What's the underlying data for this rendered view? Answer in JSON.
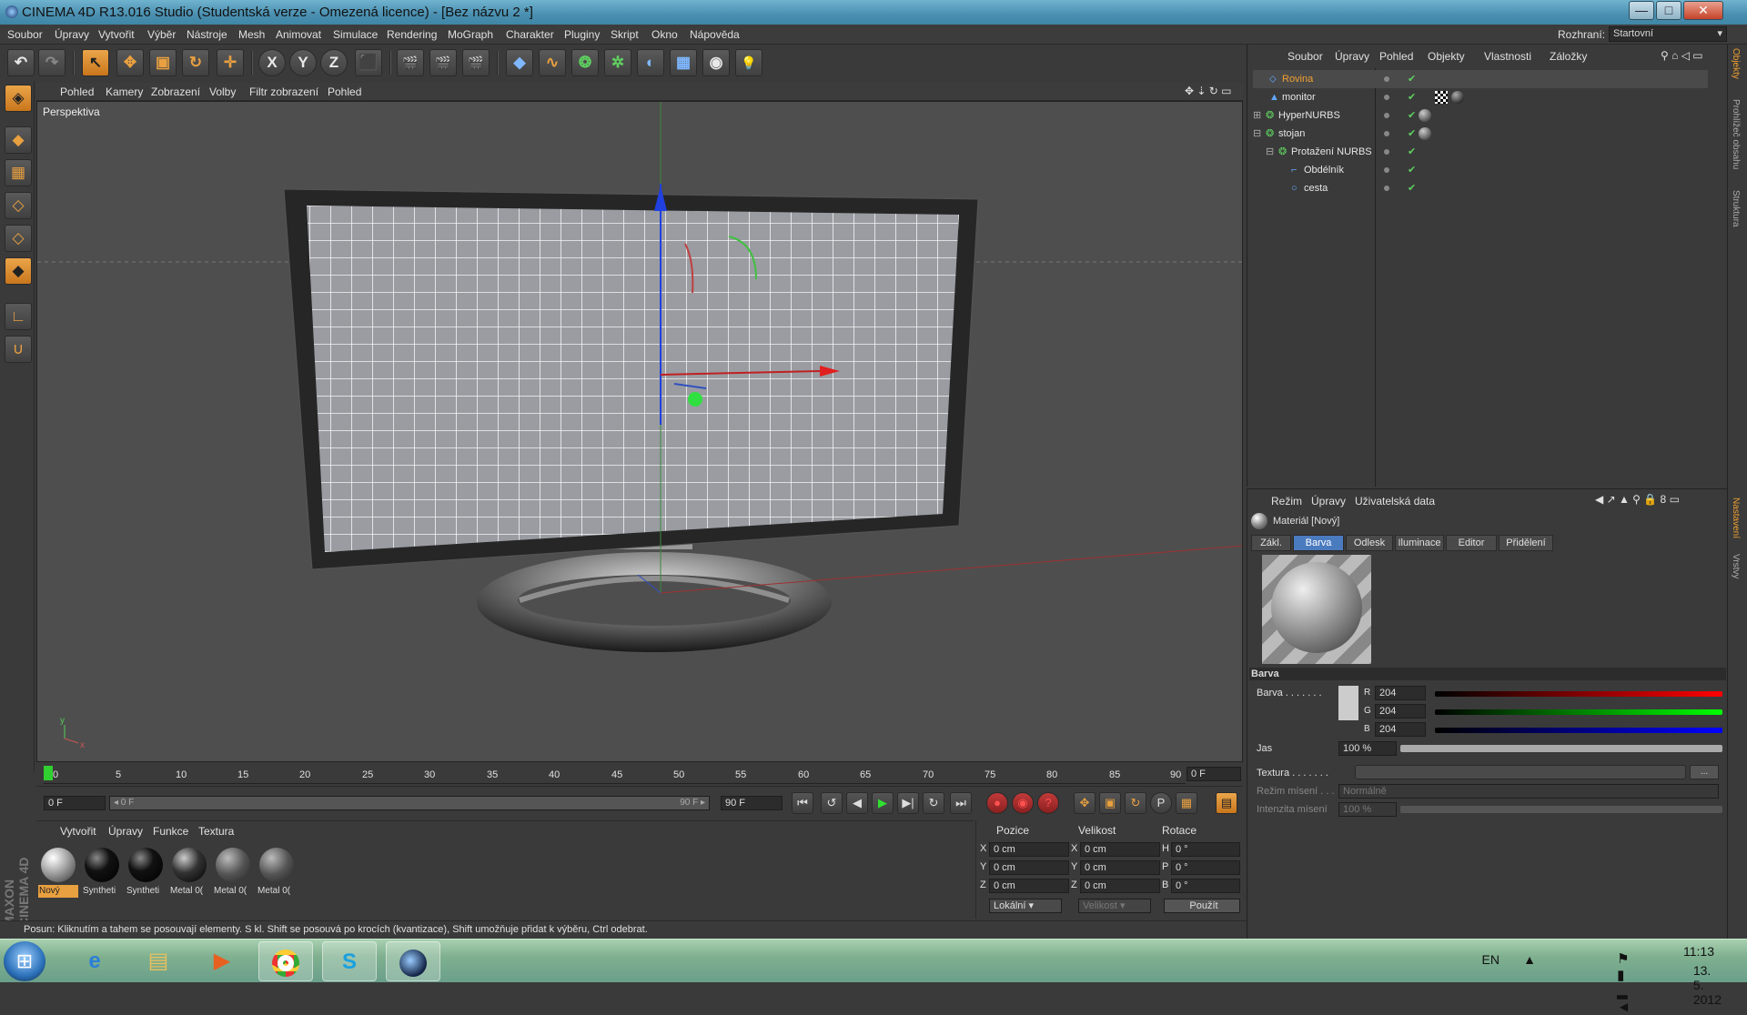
{
  "window": {
    "title": "CINEMA 4D R13.016 Studio (Studentská verze - Omezená licence) - [Bez názvu 2 *]",
    "minimize": "—",
    "maximize": "□",
    "close": "✕"
  },
  "menu": [
    "Soubor",
    "Úpravy",
    "Vytvořit",
    "Výběr",
    "Nástroje",
    "Mesh",
    "Animovat",
    "Simulace",
    "Rendering",
    "MoGraph",
    "Charakter",
    "Pluginy",
    "Skript",
    "Okno",
    "Nápověda"
  ],
  "layout": {
    "label": "Rozhraní:",
    "value": "Startovní"
  },
  "toolbar": {
    "undo": "↶",
    "redo": "↷",
    "select": "↖",
    "move": "✥",
    "scale": "▣",
    "rotate": "↻",
    "coord": "✛",
    "x": "X",
    "y": "Y",
    "z": "Z",
    "world": "⬛",
    "render_view": "🎬",
    "render_pv": "🎬",
    "render_settings": "🎬",
    "cube": "◆",
    "spline": "∿",
    "nurbs": "❂",
    "array": "✲",
    "deformer": "◐",
    "floor": "▦",
    "camera": "◉",
    "light": "💡"
  },
  "viewport": {
    "menu": [
      "Pohled",
      "Kamery",
      "Zobrazení",
      "Volby",
      "Filtr zobrazení",
      "Pohled"
    ],
    "label": "Perspektiva"
  },
  "timeline": {
    "ticks": [
      "0",
      "5",
      "10",
      "15",
      "20",
      "25",
      "30",
      "35",
      "40",
      "45",
      "50",
      "55",
      "60",
      "65",
      "70",
      "75",
      "80",
      "85",
      "90"
    ],
    "end_frame": "0 F",
    "start_field": "0 F",
    "range_start": "◂ 0 F",
    "range_end": "90 F ▸",
    "max_field": "90 F"
  },
  "transport": {
    "first": "⏮",
    "prev_key": "↺",
    "prev": "◀",
    "play": "▶",
    "next": "▶|",
    "next_key": "↻",
    "last": "⏭",
    "rec": "●",
    "auto": "◉",
    "key": "?",
    "pos": "✥",
    "scl": "▣",
    "rot": "↻",
    "param": "P",
    "pla": "▦",
    "anim": "▤"
  },
  "materials": {
    "menu": [
      "Vytvořit",
      "Úpravy",
      "Funkce",
      "Textura"
    ],
    "items": [
      {
        "label": "Nový",
        "type": "gray",
        "sel": true
      },
      {
        "label": "Syntheti",
        "type": "black"
      },
      {
        "label": "Syntheti",
        "type": "black"
      },
      {
        "label": "Metal 0(",
        "type": "metal"
      },
      {
        "label": "Metal 0(",
        "type": "rough"
      },
      {
        "label": "Metal 0(",
        "type": "rough"
      }
    ]
  },
  "coords": {
    "headers": [
      "Pozice",
      "Velikost",
      "Rotace"
    ],
    "rows": [
      {
        "a": "X",
        "pos": "0 cm",
        "b": "X",
        "size": "0 cm",
        "c": "H",
        "rot": "0 °"
      },
      {
        "a": "Y",
        "pos": "0 cm",
        "b": "Y",
        "size": "0 cm",
        "c": "P",
        "rot": "0 °"
      },
      {
        "a": "Z",
        "pos": "0 cm",
        "b": "Z",
        "size": "0 cm",
        "c": "B",
        "rot": "0 °"
      }
    ],
    "mode": "Lokální",
    "size_mode": "Velikost",
    "apply": "Použít"
  },
  "status": "Posun: Kliknutím a tahem se posouvají elementy. S kl. Shift se posouvá po krocích (kvantizace), Shift umožňuje přidat k výběru, Ctrl odebrat.",
  "objects": {
    "menu": [
      "Soubor",
      "Úpravy",
      "Pohled",
      "Objekty",
      "Vlastnosti",
      "Záložky"
    ],
    "rows": [
      {
        "name": "Rovina",
        "indent": 0,
        "icon": "⬦",
        "sel": true
      },
      {
        "name": "monitor",
        "indent": 0,
        "icon": "▲"
      },
      {
        "name": "HyperNURBS",
        "indent": 0,
        "icon": "❂",
        "exp": "⊞"
      },
      {
        "name": "stojan",
        "indent": 0,
        "icon": "❂",
        "exp": "⊟"
      },
      {
        "name": "Protažení NURBS",
        "indent": 1,
        "icon": "❂",
        "exp": "⊟"
      },
      {
        "name": "Obdélník",
        "indent": 2,
        "icon": "⌐"
      },
      {
        "name": "cesta",
        "indent": 2,
        "icon": "○"
      }
    ]
  },
  "attributes": {
    "menu": [
      "Režim",
      "Úpravy",
      "Uživatelská data"
    ],
    "title": "Materiál [Nový]",
    "tabs": [
      "Zákl.",
      "Barva",
      "Odlesk",
      "Iluminace",
      "Editor",
      "Přidělení"
    ],
    "active_tab": "Barva",
    "section": "Barva",
    "barva_label": "Barva . . . . . . .",
    "r_label": "R",
    "r": "204",
    "g_label": "G",
    "g": "204",
    "b_label": "B",
    "b": "204",
    "jas_label": "Jas",
    "jas": "100 %",
    "textura_label": "Textura . . . . . . .",
    "textura_btn": "...",
    "mix_label": "Režim mísení . . .",
    "mix_value": "Normálně",
    "mixint_label": "Intenzita mísení",
    "mixint_value": "100 %"
  },
  "right_tabs": [
    "Objekty",
    "Prohlížeč obsahu",
    "Struktura",
    "Nastavení",
    "Vrstvy"
  ],
  "taskbar": {
    "start": "⊞",
    "lang": "EN",
    "time": "11:13",
    "date": "13. 5. 2012"
  },
  "brand": "MAXON CINEMA 4D",
  "colors": {
    "accent": "#c9761c",
    "selected_tab": "#4b7bbf",
    "obj_selected": "#f0a030"
  }
}
